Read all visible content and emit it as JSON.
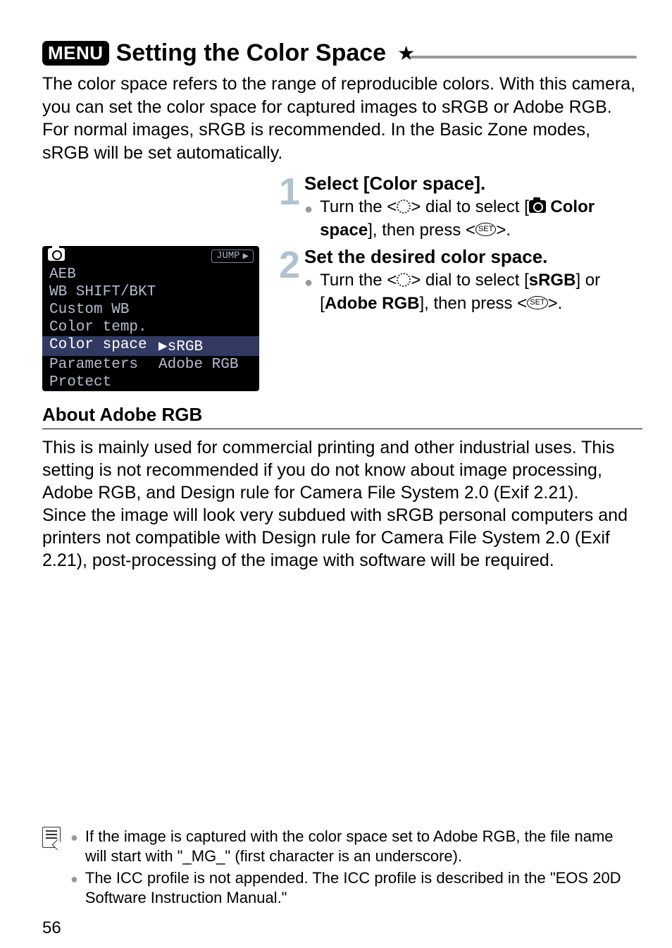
{
  "menu_label": "MENU",
  "title": "Setting the Color Space",
  "star": "★",
  "intro": "The color space refers to the range of reproducible colors. With this camera, you can set the color space for captured images to sRGB or Adobe RGB. For normal images, sRGB is recommended. In the Basic Zone modes, sRGB will be set automatically.",
  "step1": {
    "num": "1",
    "heading": "Select [Color space].",
    "bullet_pre": "Turn the <",
    "bullet_mid": "> dial to select [",
    "bullet_color_space": "Color space",
    "bullet_post": "], then press <",
    "set": "SET",
    "end": ">."
  },
  "step2": {
    "num": "2",
    "heading": "Set the desired color space.",
    "bullet_pre": "Turn the <",
    "bullet_mid": "> dial to select [",
    "srgb": "sRGB",
    "or": "] or [",
    "adobe": "Adobe RGB",
    "post": "], then press <",
    "set": "SET",
    "end": ">."
  },
  "lcd": {
    "jump": "JUMP",
    "rows": [
      {
        "lbl": "AEB",
        "val": ""
      },
      {
        "lbl": "WB SHIFT/BKT",
        "val": ""
      },
      {
        "lbl": "Custom WB",
        "val": ""
      },
      {
        "lbl": "Color temp.",
        "val": ""
      },
      {
        "lbl": "Color space",
        "val": "▶sRGB",
        "sel": true
      },
      {
        "lbl": "Parameters",
        "val": "  Adobe RGB"
      },
      {
        "lbl": "Protect",
        "val": ""
      }
    ]
  },
  "about": {
    "heading": "About Adobe RGB",
    "text": "This is mainly used for commercial printing and other industrial uses. This setting is not recommended if you do not know about image processing, Adobe RGB, and Design rule for Camera File System 2.0 (Exif 2.21).\nSince the image will look very subdued with sRGB personal computers and printers not compatible with Design rule for Camera File System 2.0 (Exif 2.21), post-processing of the image with software will be required."
  },
  "notes": [
    "If the image is captured with the color space set to Adobe RGB, the file name will start with \"_MG_\" (first character is an underscore).",
    "The ICC profile is not appended. The ICC profile is described in the \"EOS 20D Software Instruction Manual.\""
  ],
  "page": "56"
}
